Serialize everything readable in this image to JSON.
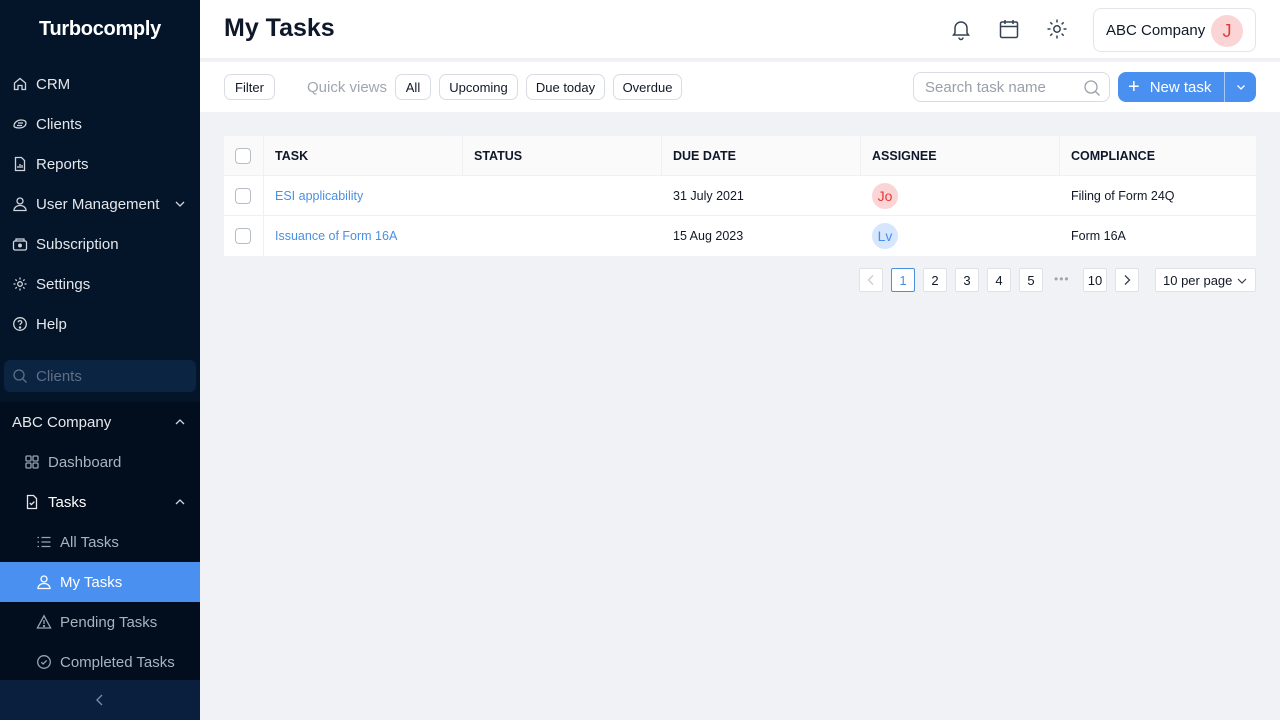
{
  "app": {
    "logo": "Turbocomply"
  },
  "sidebar": {
    "items": [
      {
        "label": "CRM",
        "icon": "home-icon"
      },
      {
        "label": "Clients",
        "icon": "handshake-icon"
      },
      {
        "label": "Reports",
        "icon": "report-icon"
      },
      {
        "label": "User Management",
        "icon": "user-icon"
      },
      {
        "label": "Subscription",
        "icon": "subscription-icon"
      },
      {
        "label": "Settings",
        "icon": "gear-icon"
      },
      {
        "label": "Help",
        "icon": "help-icon"
      }
    ],
    "search_placeholder": "Clients",
    "client": {
      "name": "ABC Company",
      "items": [
        {
          "label": "Dashboard",
          "icon": "dashboard-icon"
        },
        {
          "label": "Tasks",
          "icon": "task-file-icon"
        }
      ],
      "task_items": [
        {
          "label": "All Tasks",
          "icon": "list-icon"
        },
        {
          "label": "My Tasks",
          "icon": "user-icon",
          "active": true
        },
        {
          "label": "Pending Tasks",
          "icon": "warning-icon"
        },
        {
          "label": "Completed Tasks",
          "icon": "check-circle-icon"
        }
      ]
    }
  },
  "header": {
    "title": "My Tasks",
    "company": "ABC Company",
    "avatar_initial": "J"
  },
  "toolbar": {
    "filter_label": "Filter",
    "quick_views_label": "Quick views",
    "quick_views": [
      "All",
      "Upcoming",
      "Due today",
      "Overdue"
    ],
    "search_placeholder": "Search task name",
    "new_task_label": "New task"
  },
  "table": {
    "columns": [
      "TASK",
      "STATUS",
      "DUE DATE",
      "ASSIGNEE",
      "COMPLIANCE"
    ],
    "rows": [
      {
        "task": "ESI applicability",
        "status": "",
        "due_date": "31 July 2021",
        "assignee": "Jo",
        "compliance": "Filing of Form 24Q"
      },
      {
        "task": "Issuance of Form 16A",
        "status": "",
        "due_date": "15 Aug 2023",
        "assignee": "Lv",
        "compliance": "Form 16A"
      }
    ]
  },
  "pagination": {
    "pages": [
      "1",
      "2",
      "3",
      "4",
      "5"
    ],
    "ellipsis": "•••",
    "last_page": "10",
    "current_page": 1,
    "per_page": "10 per page"
  },
  "colors": {
    "accent": "#4a90f0",
    "sidebar_bg": "#04152a",
    "avatar_red_bg": "#fbd5d5",
    "avatar_blue_bg": "#d6e6fd"
  }
}
